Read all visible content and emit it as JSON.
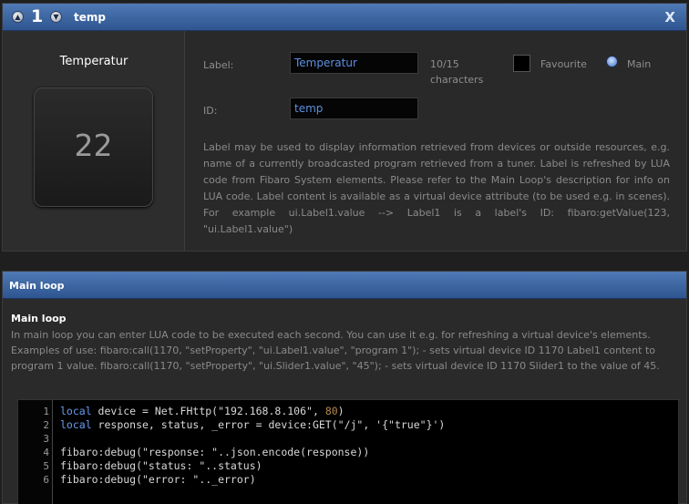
{
  "header": {
    "number": "1",
    "title": "temp",
    "close": "X",
    "prev_icon": "chevron-up-icon",
    "next_icon": "chevron-down-icon"
  },
  "device": {
    "name": "Temperatur",
    "value": "22"
  },
  "form": {
    "label_caption": "Label:",
    "label_value": "Temperatur",
    "counter": "10/15",
    "counter_unit": "characters",
    "favourite_label": "Favourite",
    "main_label": "Main",
    "id_caption": "ID:",
    "id_value": "temp",
    "description": "Label may be used to display information retrieved from devices or outside resources, e.g. name of a currently broadcasted program retrieved from a tuner. Label is refreshed by LUA code from Fibaro System elements. Please refer to the Main Loop's description for info on LUA code. Label content is available as a virtual device attribute (to be used e.g. in scenes). For example ui.Label1.value --> Label1 is a label's ID: fibaro:getValue(123, \"ui.Label1.value\")"
  },
  "main_loop": {
    "header": "Main loop",
    "title": "Main loop",
    "description": "In main loop you can enter LUA code to be executed each second. You can use it e.g. for refreshing a virtual device's elements. Examples of use: fibaro:call(1170, \"setProperty\", \"ui.Label1.value\", \"program 1\"); - sets virtual device ID 1170 Label1 content to program 1 value. fibaro:call(1170, \"setProperty\", \"ui.Slider1.value\", \"45\"); - sets virtual device ID 1170 Slider1 to the value of 45."
  },
  "code": {
    "line_numbers": [
      "1",
      "2",
      "3",
      "4",
      "5",
      "6"
    ],
    "l1_kw": "local",
    "l1_a": " device = Net.FHttp(\"192.168.8.106\", ",
    "l1_num": "80",
    "l1_b": ")",
    "l2_kw": "local",
    "l2_a": " response, status, _error = device:GET(\"/j\", '{\"true\"}')",
    "l4": "fibaro:debug(\"response: \"..json.encode(response))",
    "l5": "fibaro:debug(\"status: \"..status)",
    "l6": "fibaro:debug(\"error: \".._error)"
  },
  "colors": {
    "header_top": "#4f7ab5",
    "header_bottom": "#2e5590",
    "input_text": "#5c8fe0",
    "keyword": "#6a9cf0",
    "number": "#b58a4e"
  }
}
